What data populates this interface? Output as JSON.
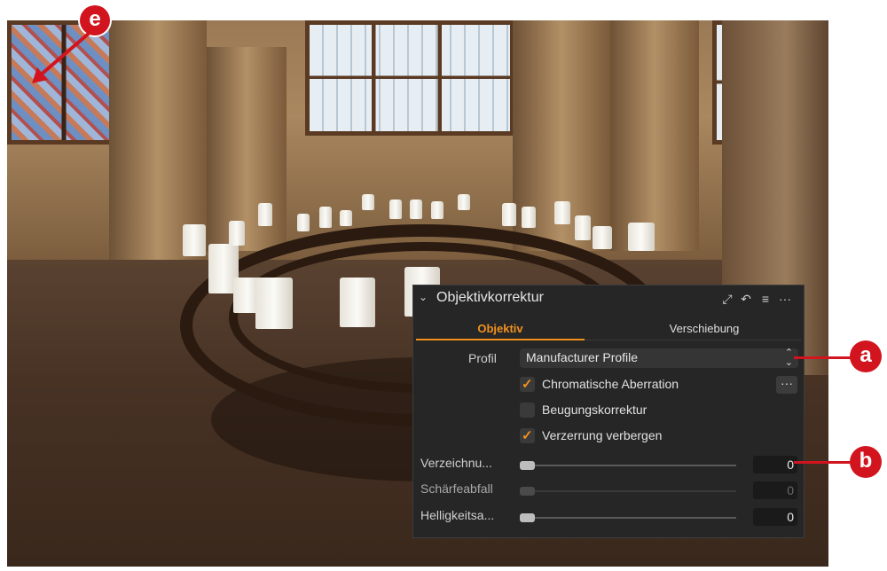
{
  "panel": {
    "title": "Objektivkorrektur",
    "tabs": [
      {
        "label": "Objektiv",
        "active": true
      },
      {
        "label": "Verschiebung",
        "active": false
      }
    ],
    "profile": {
      "label": "Profil",
      "value": "Manufacturer Profile"
    },
    "checkboxes": [
      {
        "label": "Chromatische Aberration",
        "checked": true
      },
      {
        "label": "Beugungskorrektur",
        "checked": false
      },
      {
        "label": "Verzerrung verbergen",
        "checked": true
      }
    ],
    "sliders": [
      {
        "label": "Verzeichnu...",
        "value": "0",
        "enabled": true
      },
      {
        "label": "Schärfeabfall",
        "value": "0",
        "enabled": false
      },
      {
        "label": "Helligkeitsa...",
        "value": "0",
        "enabled": true
      }
    ],
    "more_label": "···",
    "icons": [
      "chevron-down-icon",
      "expand-icon",
      "reset-icon",
      "menu-icon",
      "more-icon"
    ]
  },
  "callouts": {
    "a": "a",
    "b": "b",
    "e": "e"
  },
  "colors": {
    "accent": "#f0911e",
    "callout": "#d2141e",
    "panel_bg": "#262626"
  }
}
